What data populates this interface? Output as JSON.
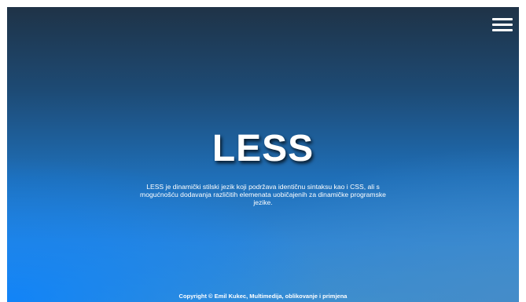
{
  "header": {
    "menu_icon": "hamburger-menu-icon"
  },
  "hero": {
    "title": "LESS",
    "description": "LESS je dinamički stilski jezik koji podržava identičnu sintaksu kao i CSS, ali s mogućnošću dodavanja različitih elemenata uobičajenih za dinamičke programske jezike."
  },
  "footer": {
    "copyright": "Copyright © Emil Kukec, Multimedija, oblikovanje i primjena"
  },
  "colors": {
    "background_top": "#1f3347",
    "background_bottom": "#3a8fd0",
    "accent_blue": "#0a82ff",
    "text": "#ffffff"
  }
}
